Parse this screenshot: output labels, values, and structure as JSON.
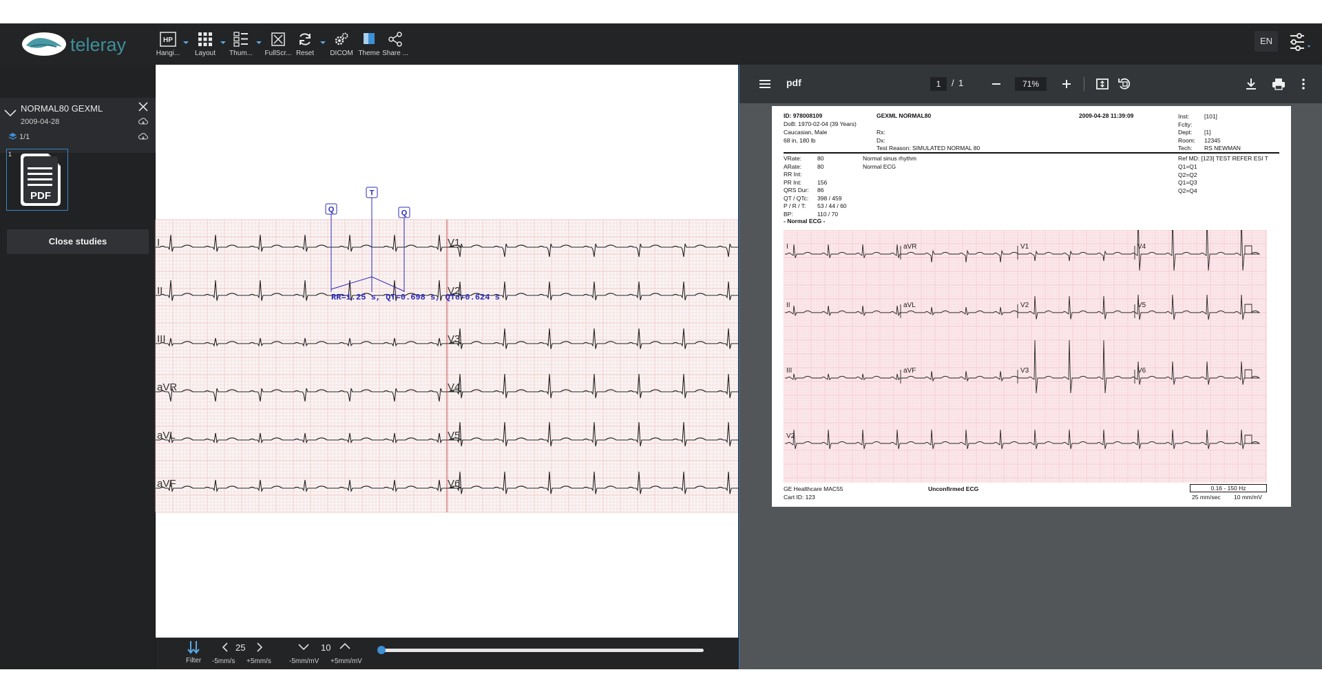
{
  "toolbar": {
    "tools": [
      {
        "label": "Hangi...",
        "icon": "hanging-protocol-icon",
        "glyph": "HP"
      },
      {
        "label": "Layout",
        "icon": "grid-icon"
      },
      {
        "label": "Thum...",
        "icon": "thumbnails-icon"
      },
      {
        "label": "FullScr...",
        "icon": "fullscreen-icon"
      },
      {
        "label": "Reset",
        "icon": "refresh-icon"
      },
      {
        "label": "DICOM",
        "icon": "gears-icon"
      },
      {
        "label": "Theme",
        "icon": "theme-icon"
      },
      {
        "label": "Share ...",
        "icon": "share-icon"
      }
    ],
    "language": "EN",
    "accent": "#5aa9e6",
    "brand_color": "#3f8f9a"
  },
  "sidebar": {
    "study_name": "NORMAL80 GEXML",
    "study_date": "2009-04-28",
    "series_count": "1/1",
    "thumb_index": "1",
    "thumb_label": "PDF",
    "close_button": "Close studies"
  },
  "ecg": {
    "leads_left": [
      "I",
      "II",
      "III",
      "aVR",
      "aVL",
      "aVF"
    ],
    "leads_right": [
      "V1",
      "V2",
      "V3",
      "V4",
      "V5",
      "V6"
    ],
    "markers": [
      "Q",
      "T",
      "Q"
    ],
    "measurement": "RR=1.25 s, QT=0.698 s, QTc=0.624 s",
    "grid_color": "#f0c8c8",
    "trace_color": "#222222",
    "annotation_color": "#2b2bb8"
  },
  "ecg_bar": {
    "filter_label": "Filter",
    "speed_value": "25",
    "speed_minus_label": "-5mm/s",
    "speed_plus_label": "+5mm/s",
    "gain_value": "10",
    "gain_minus_label": "-5mm/mV",
    "gain_plus_label": "+5mm/mV",
    "slider_position": 0.0
  },
  "pdf": {
    "title": "pdf",
    "page_current": "1",
    "page_separator": "/",
    "page_total": "1",
    "zoom": "71%",
    "report": {
      "id": "ID: 978008109",
      "name": "GEXML NORMAL80",
      "datetime": "2009-04-28  11:39:09",
      "dob": "DoB: 1970-02-04  (39 Years)",
      "ethnicity": "Caucasian, Male",
      "size": "68 in, 180 lb",
      "rx": "Rx:",
      "dx": "Dx:",
      "test_reason": "Test Reason: SIMULATED NORMAL 80",
      "right_labels": [
        "Inst:",
        "Fclty:",
        "Dept:",
        "Room:",
        "Tech:"
      ],
      "right_values": [
        "[101]",
        "",
        "[1]",
        "12345",
        "RS NEWMAN"
      ],
      "meas_labels": [
        "VRate:",
        "ARate:",
        "RR Int:",
        "PR Int:",
        "QRS Dur:",
        "QT / QTc:",
        "P / R / T:",
        "BP:"
      ],
      "meas_values": [
        "80",
        "80",
        "",
        "156",
        "86",
        "398 / 459",
        "53 / 44 / 60",
        "110 / 70"
      ],
      "interpretation": [
        "Normal sinus rhythm",
        "Normal ECG"
      ],
      "summary": "- Normal ECG -",
      "ref_md": "Ref MD: [123] TEST REFER ESI T",
      "q_list": [
        "Q1=Q1",
        "Q2=Q2",
        "Q1=Q3",
        "Q2=Q4"
      ],
      "grid_leads": [
        [
          "I",
          "aVR",
          "V1",
          "V4"
        ],
        [
          "II",
          "aVL",
          "V2",
          "V5"
        ],
        [
          "III",
          "aVF",
          "V3",
          "V6"
        ],
        [
          "V2"
        ]
      ],
      "device": "GE Healthcare MAC55",
      "cart": "Cart ID: 123",
      "unconfirmed": "Unconfirmed ECG",
      "filter": "0.16 - 150 Hz",
      "speed": "25 mm/sec",
      "gain": "10 mm/mV",
      "grid_color": "#f6c9d0"
    }
  }
}
